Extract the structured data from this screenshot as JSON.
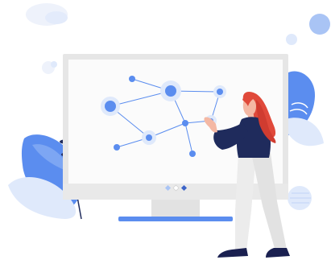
{
  "illustration": {
    "subject": "woman-presenting-network-diagram-on-monitor",
    "colors": {
      "accent_blue": "#5b8def",
      "light_blue": "#a9c4f5",
      "pale_blue": "#dfe9fb",
      "navy": "#1f2b5c",
      "hair_red": "#e0493a",
      "skin": "#f4b8a4",
      "monitor_frame": "#e6e6e6",
      "monitor_screen": "#fbfbfb",
      "pants": "#ececec",
      "shoes": "#1a2050"
    },
    "icons": [
      "monitor",
      "network-graph",
      "person",
      "leaf",
      "blob"
    ]
  }
}
